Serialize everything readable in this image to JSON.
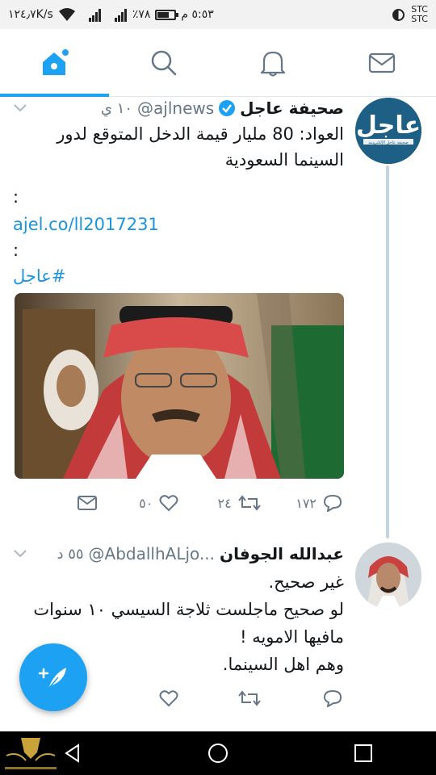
{
  "status_bar": {
    "time": "٥:٥٣ م",
    "battery": "٧٨٪",
    "network_2g": "2G",
    "network_4g": "4G",
    "speed": "١٢٤٫٧K/s",
    "carrier_1": "STC",
    "carrier_2": "STC"
  },
  "tabs": [
    {
      "icon": "home-icon",
      "active": true
    },
    {
      "icon": "search-icon",
      "active": false
    },
    {
      "icon": "notifications-icon",
      "active": false
    },
    {
      "icon": "messages-icon",
      "active": false
    }
  ],
  "accent_color": "#1da1f2",
  "tweets": [
    {
      "name": "صحيفة عاجل",
      "handle": "@ajlnews",
      "time": "١٠ ي",
      "avatar_text": "عاجل",
      "avatar_subtext": "صحيفة عاجل الإلكترونية",
      "text": "العواد: 80 مليار قيمة الدخل المتوقع لدور السينما السعودية",
      "colon_1": ":",
      "link": "ajel.co/ll2017231",
      "colon_2": ":",
      "hashtag": "#عاجل",
      "replies": "١٧٢",
      "retweets": "٢٤",
      "likes": "٥٠"
    },
    {
      "name": "عبدالله الجوفان",
      "handle": "@AbdallhALjo...",
      "time": "٥٥ د",
      "line_1": "غير صحيح.",
      "line_2": "لو صحيح ماجلست ثلاجة السيسي ١٠ سنوات",
      "line_3": "مافيها الامويه !",
      "line_4": "وهم اهل السينما."
    }
  ]
}
